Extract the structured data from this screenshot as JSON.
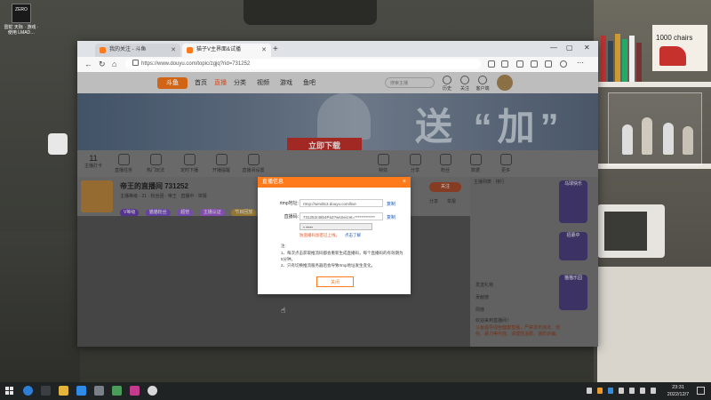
{
  "desktop": {
    "icon_badge": "ZERO",
    "icon_label": "雷蛇 天际 · 游戏 · 使用 LMAD…",
    "poster_text": "1000 chairs"
  },
  "browser": {
    "tabs": [
      {
        "label": "我的关注 - 斗鱼",
        "active": false
      },
      {
        "label": "猫子V主界面&试播",
        "active": true
      }
    ],
    "new_tab": "+",
    "url": "https://www.douyu.com/topic/zgjq?rid=731252"
  },
  "site": {
    "logo": "斗鱼",
    "nav": [
      "首页",
      "直播",
      "分类",
      "视频",
      "游戏",
      "鱼吧"
    ],
    "search_placeholder": "搜索主播",
    "header_icons": [
      "历史",
      "关注",
      "客户端"
    ],
    "banner_text": "送 “加”",
    "banner_button": "立即下载",
    "tools": [
      {
        "num": "11",
        "label": "主播打卡"
      },
      {
        "label": "直播任务"
      },
      {
        "label": "热门玩法"
      },
      {
        "label": "定时下播"
      },
      {
        "label": "开播提醒"
      },
      {
        "label": "直播间设置"
      },
      {
        "label": "特效"
      },
      {
        "label": "分享"
      },
      {
        "label": "粉丝"
      },
      {
        "label": "数据"
      },
      {
        "label": "更多"
      }
    ],
    "room": {
      "title": "帝王的直播间 731252",
      "meta": "主播等级 · 21 · 粉丝团 · 帝王 · 直播中 · 举报",
      "chips": [
        "V等级",
        "猫猫粉丝",
        "超管",
        "主播认证",
        "节目回放"
      ],
      "follow": "关注",
      "share": "分享",
      "report": "举报"
    },
    "side": {
      "tabs": "主播列表 · 排行",
      "lines": [
        "发送礼物",
        "贡献榜",
        "周榜",
        "欢迎来到直播间！"
      ],
      "notice": "斗鱼倡导绿色健康直播，严禁发布违法、低俗、暴力等内容。请理性消费，谨防诈骗。",
      "badge1": "乌球快乐",
      "badge2": "猫猫乐园",
      "badge3": "招募中"
    }
  },
  "modal": {
    "title": "直播信息",
    "close": "×",
    "rtmp_label": "rtmp地址:",
    "rtmp_value": "rtmp://sendtc3.douyu.com/live",
    "code_label": "直播码:",
    "code_value": "731252r48b4Pa3?wsSecret=*************",
    "copy": "复制",
    "select_value": "▪ ▪▪▪▪▪",
    "warn_text": "防盗播码加密已上线，",
    "warn_link": "点击了解",
    "note_head": "注:",
    "note1": "1、每次点击获取推流码都会重新生成直播码，每个直播码的有效期为5分钟。",
    "note2": "2、只有切换推流服务器后会导致rtmp地址发生变化。",
    "confirm": "关闭"
  },
  "taskbar": {
    "time": "23:31",
    "date": "2022/12/7"
  },
  "colors": {
    "accent": "#ff7a1b",
    "banner_btn": "#c5312b",
    "link": "#1e5bb8"
  }
}
